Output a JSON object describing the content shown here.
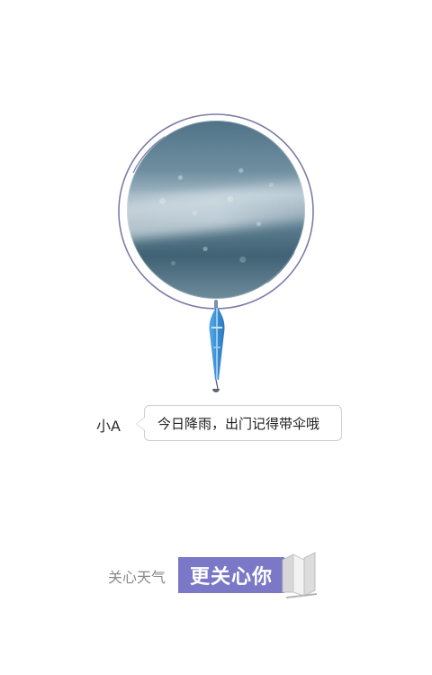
{
  "chat": {
    "speaker": "小A",
    "message": "今日降雨，出门记得带伞哦"
  },
  "footer": {
    "prefix": "关心天气",
    "highlight": "更关心你"
  },
  "colors": {
    "accent": "#7b78c7",
    "umbrella_blue": "#3f95d8",
    "ring": "#7c7aa7"
  },
  "icons": {
    "umbrella": "umbrella-icon",
    "book": "book-icon"
  }
}
